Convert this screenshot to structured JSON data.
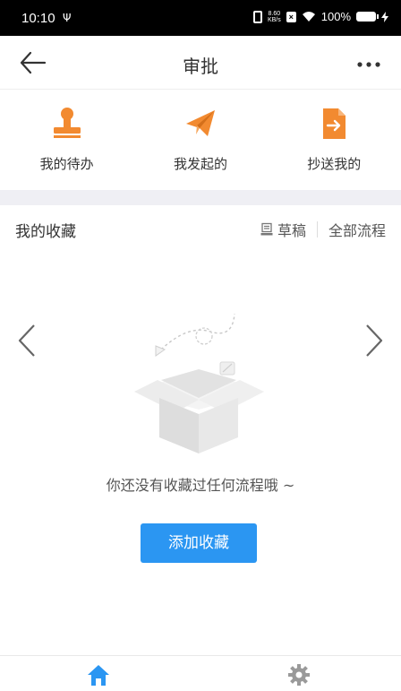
{
  "status_bar": {
    "time": "10:10",
    "net_speed_value": "8.60",
    "net_speed_unit": "KB/s",
    "battery": "100%"
  },
  "nav": {
    "title": "审批"
  },
  "shortcuts": [
    {
      "label": "我的待办",
      "icon": "stamp-icon"
    },
    {
      "label": "我发起的",
      "icon": "paper-plane-icon"
    },
    {
      "label": "抄送我的",
      "icon": "document-forward-icon"
    }
  ],
  "favorites": {
    "title": "我的收藏",
    "draft_label": "草稿",
    "all_process_label": "全部流程",
    "empty_text": "你还没有收藏过任何流程哦 ~",
    "add_button_label": "添加收藏"
  },
  "colors": {
    "accent_orange": "#f28a30",
    "primary_blue": "#2b96f2"
  }
}
